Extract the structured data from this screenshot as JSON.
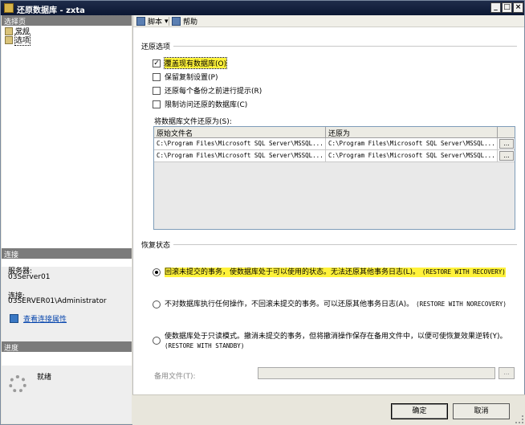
{
  "window": {
    "title": "还原数据库 - zxta",
    "minimize": "_",
    "maximize": "□",
    "close": "×"
  },
  "left": {
    "select_page_header": "选择页",
    "pages": [
      {
        "label": "常规",
        "icon": "page-icon"
      },
      {
        "label": "选项",
        "icon": "page-icon"
      }
    ],
    "connection_header": "连接",
    "server_label": "服务器:",
    "server_value": "03Server01",
    "connection_label": "连接:",
    "connection_value": "03SERVER01\\Administrator",
    "view_props_link": "查看连接属性",
    "progress_header": "进度",
    "progress_status": "就绪"
  },
  "toolbar": {
    "script_label": "脚本",
    "script_arrow": "▾",
    "help_label": "帮助"
  },
  "restore_options": {
    "section_title": "还原选项",
    "options": [
      {
        "label": "覆盖现有数据库(O)",
        "checked": true,
        "check_mark": "✓"
      },
      {
        "label": "保留复制设置(P)",
        "checked": false,
        "check_mark": ""
      },
      {
        "label": "还原每个备份之前进行提示(R)",
        "checked": false,
        "check_mark": ""
      },
      {
        "label": "限制访问还原的数据库(C)",
        "checked": false,
        "check_mark": ""
      }
    ]
  },
  "file_grid": {
    "label": "将数据库文件还原为(S):",
    "headers": [
      "原始文件名",
      "还原为"
    ],
    "rows": [
      {
        "original": "C:\\Program Files\\Microsoft SQL Server\\MSSQL...",
        "restore_as": "C:\\Program Files\\Microsoft SQL Server\\MSSQL...",
        "button": "..."
      },
      {
        "original": "C:\\Program Files\\Microsoft SQL Server\\MSSQL...",
        "restore_as": "C:\\Program Files\\Microsoft SQL Server\\MSSQL...",
        "button": "..."
      }
    ]
  },
  "recovery": {
    "section_title": "恢复状态",
    "options": [
      {
        "text": "回滚未提交的事务，使数据库处于可以使用的状态。无法还原其他事务日志(L)。",
        "suffix": "(RESTORE WITH RECOVERY)",
        "selected": true
      },
      {
        "text": "不对数据库执行任何操作，不回滚未提交的事务。可以还原其他事务日志(A)。",
        "suffix": "(RESTORE WITH NORECOVERY)",
        "selected": false
      },
      {
        "text": "使数据库处于只读模式。撤消未提交的事务，但将撤消操作保存在备用文件中，以便可使恢复效果逆转(Y)。",
        "suffix": "(RESTORE WITH STANDBY)",
        "selected": false
      }
    ],
    "standby_file_label": "备用文件(T):",
    "standby_file_value": "",
    "standby_browse": "..."
  },
  "footer": {
    "ok": "确定",
    "cancel": "取消"
  }
}
